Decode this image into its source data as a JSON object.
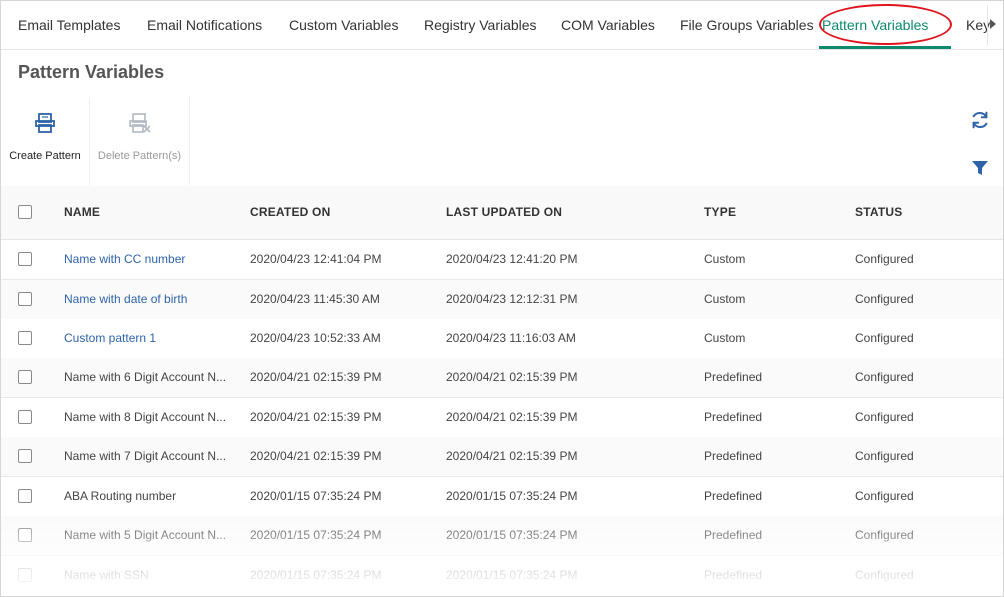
{
  "tabs": {
    "items": [
      {
        "label": "Email Templates"
      },
      {
        "label": "Email Notifications"
      },
      {
        "label": "Custom Variables"
      },
      {
        "label": "Registry Variables"
      },
      {
        "label": "COM Variables"
      },
      {
        "label": "File Groups Variables"
      },
      {
        "label": "Pattern Variables",
        "active": true
      }
    ],
    "overflow_label": "Key"
  },
  "page": {
    "title": "Pattern Variables"
  },
  "toolbar": {
    "create_label": "Create Pattern",
    "delete_label": "Delete Pattern(s)",
    "create_icon": "create-pattern-icon",
    "delete_icon": "delete-pattern-icon",
    "refresh_icon": "refresh-icon",
    "filter_icon": "filter-icon"
  },
  "table": {
    "columns": {
      "name": "NAME",
      "created": "CREATED ON",
      "updated": "LAST UPDATED ON",
      "type": "TYPE",
      "status": "STATUS"
    },
    "rows": [
      {
        "name": "Name with CC number",
        "created": "2020/04/23 12:41:04 PM",
        "updated": "2020/04/23 12:41:20 PM",
        "type": "Custom",
        "status": "Configured"
      },
      {
        "name": "Name with date of birth",
        "created": "2020/04/23 11:45:30 AM",
        "updated": "2020/04/23 12:12:31 PM",
        "type": "Custom",
        "status": "Configured"
      },
      {
        "name": "Custom pattern 1",
        "created": "2020/04/23 10:52:33 AM",
        "updated": "2020/04/23 11:16:03 AM",
        "type": "Custom",
        "status": "Configured"
      },
      {
        "name": "Name with 6 Digit Account N...",
        "created": "2020/04/21 02:15:39 PM",
        "updated": "2020/04/21 02:15:39 PM",
        "type": "Predefined",
        "status": "Configured"
      },
      {
        "name": "Name with 8 Digit Account N...",
        "created": "2020/04/21 02:15:39 PM",
        "updated": "2020/04/21 02:15:39 PM",
        "type": "Predefined",
        "status": "Configured"
      },
      {
        "name": "Name with 7 Digit Account N...",
        "created": "2020/04/21 02:15:39 PM",
        "updated": "2020/04/21 02:15:39 PM",
        "type": "Predefined",
        "status": "Configured"
      },
      {
        "name": "ABA Routing number",
        "created": "2020/01/15 07:35:24 PM",
        "updated": "2020/01/15 07:35:24 PM",
        "type": "Predefined",
        "status": "Configured"
      },
      {
        "name": "Name with 5 Digit Account N...",
        "created": "2020/01/15 07:35:24 PM",
        "updated": "2020/01/15 07:35:24 PM",
        "type": "Predefined",
        "status": "Configured"
      },
      {
        "name": "Name with SSN",
        "created": "2020/01/15 07:35:24 PM",
        "updated": "2020/01/15 07:35:24 PM",
        "type": "Predefined",
        "status": "Configured"
      }
    ]
  },
  "colors": {
    "accent": "#0c8a6b",
    "link": "#2f63a8",
    "highlight_ring": "#e0141e"
  }
}
